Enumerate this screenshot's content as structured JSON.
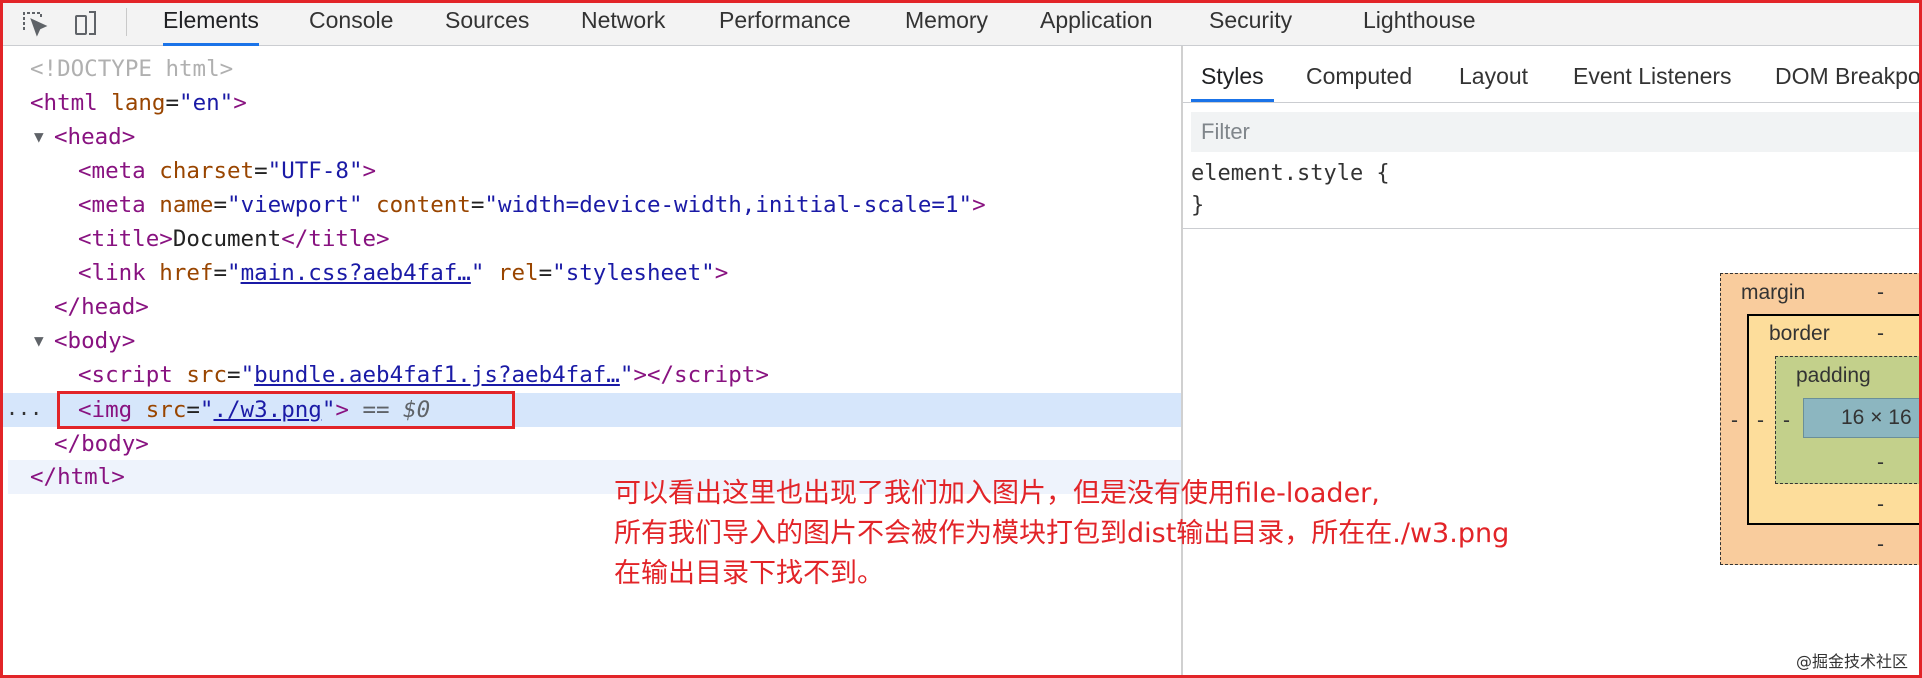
{
  "toolbar": {
    "tabs": [
      "Elements",
      "Console",
      "Sources",
      "Network",
      "Performance",
      "Memory",
      "Application",
      "Security",
      "Lighthouse"
    ],
    "active_tab": "Elements"
  },
  "dom": {
    "doctype": "<!DOCTYPE html>",
    "html_tag": "html",
    "lang_attr": "lang",
    "lang_val": "en",
    "head_tag": "head",
    "meta": "meta",
    "charset_attr": "charset",
    "charset_val": "UTF-8",
    "name_attr": "name",
    "name_val": "viewport",
    "content_attr": "content",
    "content_val": "width=device-width,initial-scale=1",
    "title_tag": "title",
    "title_text": "Document",
    "link_tag": "link",
    "href_attr": "href",
    "href_val": "main.css?aeb4faf…",
    "rel_attr": "rel",
    "rel_val": "stylesheet",
    "body_tag": "body",
    "script_tag": "script",
    "src_attr": "src",
    "script_src": "bundle.aeb4faf1.js?aeb4faf…",
    "img_tag": "img",
    "img_src": "./w3.png",
    "eq": "==",
    "dollar": "$0",
    "ellipsis": "..."
  },
  "sidebar": {
    "tabs": [
      "Styles",
      "Computed",
      "Layout",
      "Event Listeners",
      "DOM Breakpo"
    ],
    "active_tab": "Styles",
    "filter_placeholder": "Filter",
    "element_style_open": "element.style {",
    "element_style_close": "}"
  },
  "box_model": {
    "margin": "margin",
    "border": "border",
    "padding": "padding",
    "content": "16 × 16",
    "dash": "-"
  },
  "annotation": {
    "lines": [
      "可以看出这里也出现了我们加入图片，但是没有使用file-loader,",
      "所有我们导入的图片不会被作为模块打包到dist输出目录，所在在./w3.png",
      "在输出目录下找不到。"
    ],
    "color": "#e22428"
  },
  "watermark": "@掘金技术社区",
  "colors": {
    "tag": "#881280",
    "attr": "#994500",
    "value": "#1a1aa6",
    "accent": "#1a73e8",
    "selected_row": "#d6e6fb",
    "margin": "#f9cc9d",
    "border": "#fddd9b",
    "padding": "#c3d08b",
    "content": "#8cb6c0"
  }
}
